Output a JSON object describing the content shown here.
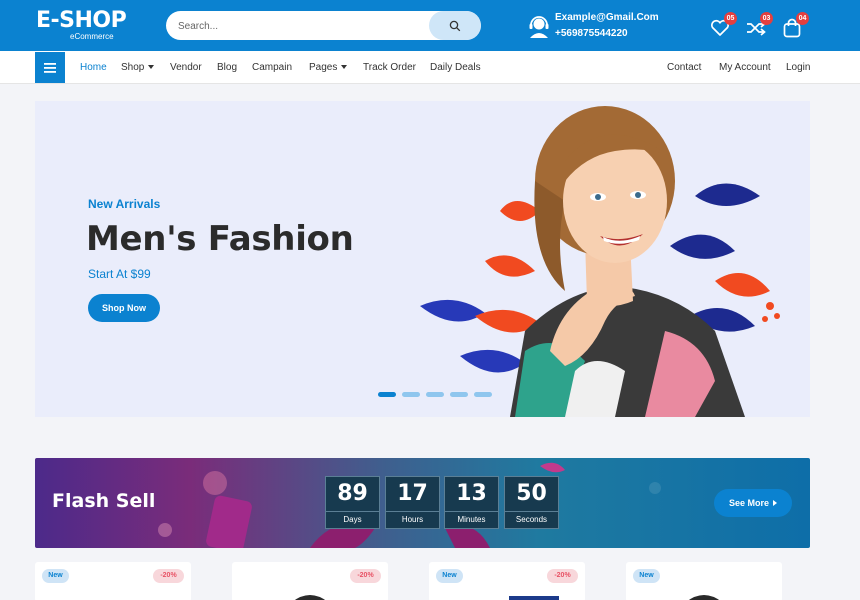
{
  "header": {
    "logo_text": "E-SHOP",
    "logo_sub": "eCommerce",
    "search_placeholder": "Search...",
    "email": "Example@Gmail.Com",
    "phone": "+569875544220",
    "wishlist_count": "05",
    "compare_count": "03",
    "cart_count": "04"
  },
  "nav": {
    "items": [
      "Home",
      "Shop",
      "Vendor",
      "Blog",
      "Campain",
      "Pages",
      "Track Order",
      "Daily Deals"
    ],
    "right": [
      "Contact",
      "My Account",
      "Login"
    ]
  },
  "hero": {
    "kicker": "New Arrivals",
    "title": "Men's Fashion",
    "price": "Start At $99",
    "button": "Shop Now",
    "slides": 5,
    "active_slide": 1
  },
  "flash": {
    "title": "Flash Sell",
    "countdown": [
      {
        "value": "89",
        "label": "Days"
      },
      {
        "value": "17",
        "label": "Hours"
      },
      {
        "value": "13",
        "label": "Minutes"
      },
      {
        "value": "50",
        "label": "Seconds"
      }
    ],
    "button": "See More"
  },
  "products": [
    {
      "badge": "New",
      "discount": "-20%"
    },
    {
      "badge": "",
      "discount": "-20%"
    },
    {
      "badge": "New",
      "discount": "-20%"
    },
    {
      "badge": "New",
      "discount": ""
    }
  ],
  "colors": {
    "primary": "#0b82d0",
    "hero_bg": "#eaedfb",
    "badge": "#e43f3f"
  }
}
